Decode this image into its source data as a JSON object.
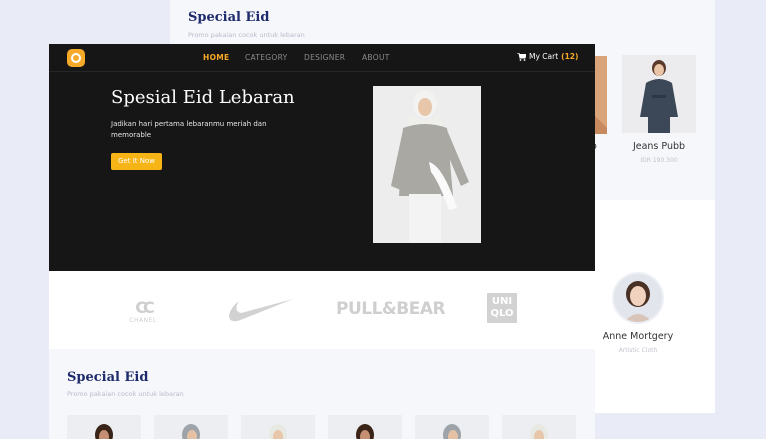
{
  "background_page": {
    "section_title": "Special Eid",
    "section_subtitle": "Promo pakaian cocok untuk lebaran",
    "product": {
      "name": "Jeans Pubb",
      "price": "IDR 190.300"
    },
    "partial_product_name_tail": "o",
    "person": {
      "name": "Anne Mortgery",
      "role": "Artistic Cloth"
    }
  },
  "nav": {
    "items": [
      "HOME",
      "CATEGORY",
      "DESIGNER",
      "ABOUT"
    ],
    "cart_label": "My Cart",
    "cart_count": "(12)"
  },
  "hero": {
    "title": "Spesial Eid Lebaran",
    "text": "Jadikan hari pertama lebaranmu meriah dan memorable",
    "button": "Get It Now"
  },
  "brands": {
    "chanel": "CHANEL",
    "pullbear": "PULL&BEAR",
    "uniqlo_1": "UNI",
    "uniqlo_2": "QLO"
  },
  "section2": {
    "title": "Special Eid",
    "subtitle": "Promo pakaian cocok untuk lebaran"
  },
  "colors": {
    "accent": "#f7a928",
    "dark": "#161616",
    "navy": "#1d2a6b"
  }
}
